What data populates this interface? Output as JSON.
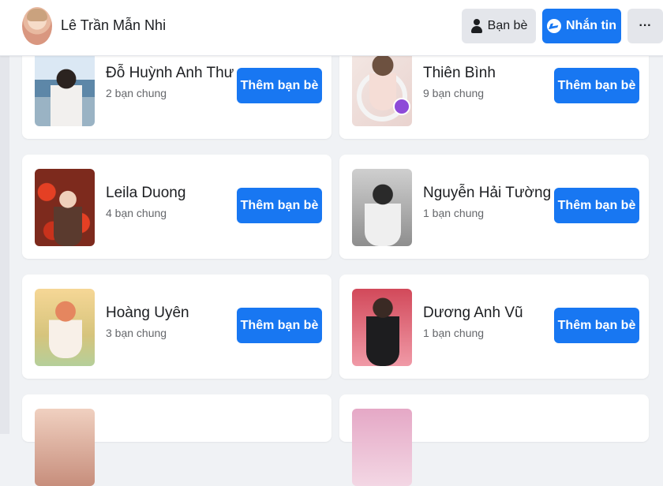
{
  "header": {
    "profile_name": "Lê Trần Mẫn Nhi",
    "friends_button": "Bạn bè",
    "message_button": "Nhắn tin",
    "more_button": "···"
  },
  "add_friend_label": "Thêm bạn bè",
  "friends": [
    {
      "name": "Đỗ Huỳnh Anh Thư",
      "mutual": "2 bạn chung"
    },
    {
      "name": "Thiên Bình",
      "mutual": "9 bạn chung"
    },
    {
      "name": "Leila Duong",
      "mutual": "4 bạn chung"
    },
    {
      "name": "Nguyễn Hải Tường",
      "mutual": "1 bạn chung"
    },
    {
      "name": "Hoàng Uyên",
      "mutual": "3 bạn chung"
    },
    {
      "name": "Dương Anh Vũ",
      "mutual": "1 bạn chung"
    }
  ],
  "colors": {
    "primary": "#1877f2",
    "background": "#f0f2f5",
    "secondary_button": "#e4e6eb",
    "muted_text": "#65676b"
  }
}
